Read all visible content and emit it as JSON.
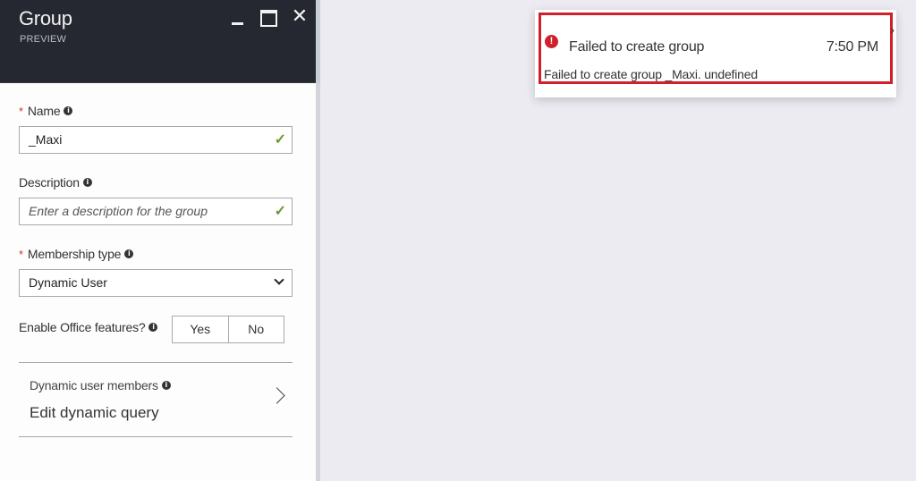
{
  "blade": {
    "title": "Group",
    "subtitle": "PREVIEW",
    "controls": {
      "minimize": "minimize",
      "maximize": "maximize",
      "close": "✕"
    }
  },
  "form": {
    "name": {
      "label": "Name",
      "required_mark": "*",
      "value": "_Maxi",
      "valid": "✓"
    },
    "description": {
      "label": "Description",
      "placeholder": "Enter a description for the group",
      "valid": "✓"
    },
    "membership": {
      "label": "Membership type",
      "required_mark": "*",
      "selected": "Dynamic User"
    },
    "office": {
      "label": "Enable Office features?",
      "options": [
        "Yes",
        "No"
      ]
    },
    "dynamic_members": {
      "label": "Dynamic user members",
      "action": "Edit dynamic query"
    },
    "info_glyph": "i"
  },
  "notification": {
    "icon": "!",
    "title": "Failed to create group",
    "time": "7:50 PM",
    "message": "Failed to create group _Maxi. undefined",
    "expand": "›",
    "highlight_color": "#d0202c"
  }
}
